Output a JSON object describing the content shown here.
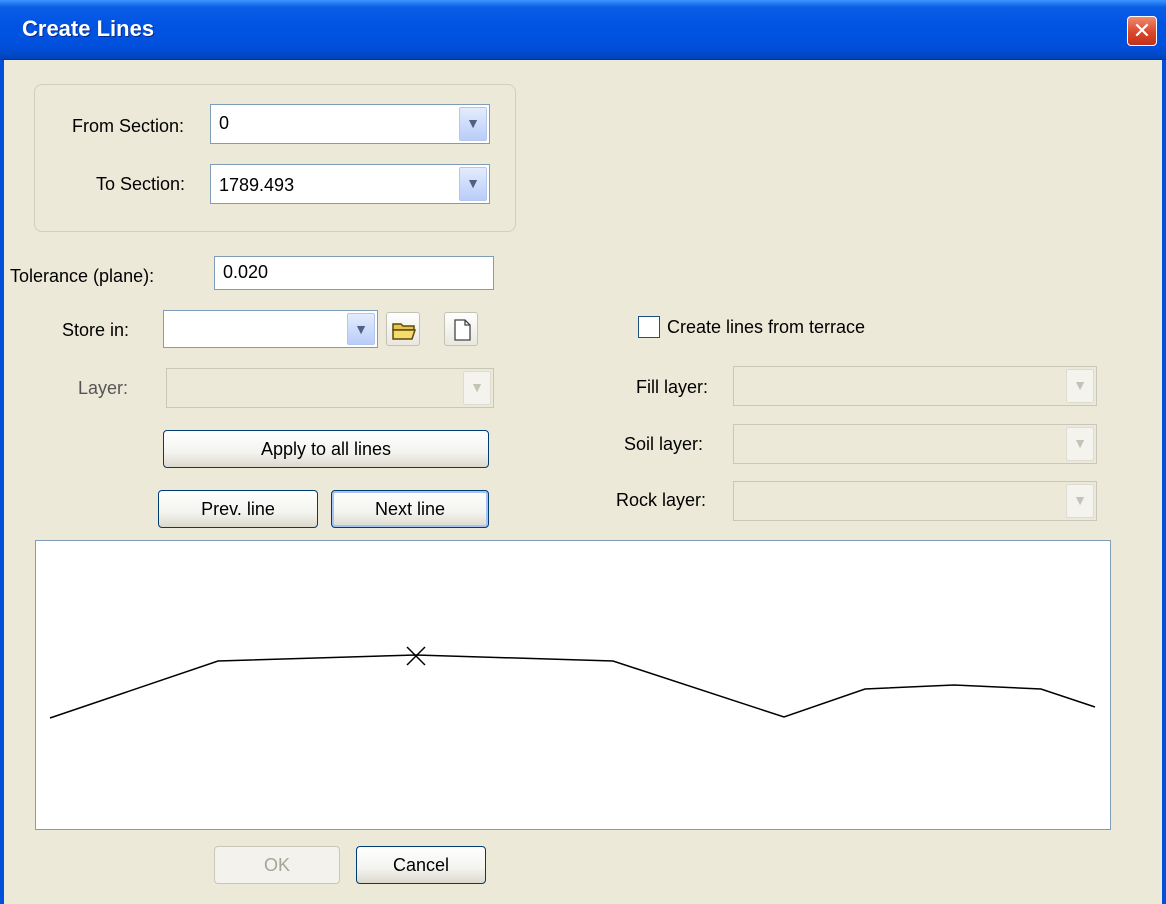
{
  "window": {
    "title": "Create Lines",
    "close_glyph": "✕"
  },
  "from_section": {
    "label": "From Section:",
    "value": "0"
  },
  "to_section": {
    "label": "To Section:",
    "value": "1789.493"
  },
  "tolerance": {
    "label": "Tolerance (plane):",
    "value": "0.020"
  },
  "store_in": {
    "label": "Store in:",
    "value": "",
    "open_icon": "folder-open-icon",
    "new_icon": "new-file-icon"
  },
  "layer": {
    "label": "Layer:",
    "value": ""
  },
  "apply_all_label": "Apply to all lines",
  "prev_line_label": "Prev. line",
  "next_line_label": "Next line",
  "terrace": {
    "label": "Create lines from terrace",
    "checked": false
  },
  "fill_layer": {
    "label": "Fill layer:",
    "value": ""
  },
  "soil_layer": {
    "label": "Soil layer:",
    "value": ""
  },
  "rock_layer": {
    "label": "Rock layer:",
    "value": ""
  },
  "ok_label": "OK",
  "cancel_label": "Cancel",
  "profile": {
    "line_color": "#000000",
    "marker_icon": "x-marker-icon"
  }
}
